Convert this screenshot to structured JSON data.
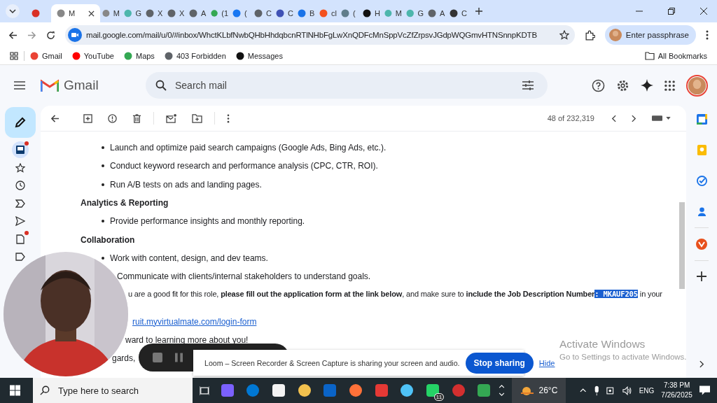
{
  "tabs": [
    {
      "selected": false
    },
    {
      "label": "M",
      "selected": true
    },
    {
      "label": "M",
      "selected": false
    },
    {
      "label": "G",
      "selected": false
    },
    {
      "label": "X",
      "selected": false
    },
    {
      "label": "X",
      "selected": false
    },
    {
      "label": "A",
      "selected": false
    },
    {
      "label": "(1",
      "selected": false
    },
    {
      "label": "(",
      "selected": false
    },
    {
      "label": "C",
      "selected": false
    },
    {
      "label": "C",
      "selected": false
    },
    {
      "label": "B",
      "selected": false
    },
    {
      "label": "cl",
      "selected": false
    },
    {
      "label": "(",
      "selected": false
    },
    {
      "label": "H",
      "selected": false
    },
    {
      "label": "M",
      "selected": false
    },
    {
      "label": "G",
      "selected": false
    },
    {
      "label": "A",
      "selected": false
    },
    {
      "label": "C",
      "selected": false
    }
  ],
  "address_bar": {
    "url": "mail.google.com/mail/u/0/#inbox/WhctKLbfNwbQHbHhdqbcnRTlNHbFgLwXnQDFcMnSppVcZfZrpsvJGdpWQGmvHTNSnnpKDTB"
  },
  "profile_button": "Enter passphrase",
  "bookmarks": [
    "Gmail",
    "YouTube",
    "Maps",
    "403 Forbidden",
    "Messages"
  ],
  "all_bookmarks": "All Bookmarks",
  "gmail": {
    "logo": "Gmail",
    "search": {
      "placeholder": "Search mail"
    },
    "counter": "48 of 232,319"
  },
  "sidebar": [
    {
      "badge": true,
      "selected": true
    },
    {
      "badge": false,
      "selected": false
    },
    {
      "badge": false,
      "selected": false
    },
    {
      "badge": false,
      "selected": false
    },
    {
      "badge": false,
      "selected": false
    },
    {
      "badge": true,
      "selected": false
    },
    {
      "badge": false,
      "selected": false
    }
  ],
  "email_lines": [
    {
      "kind": "bullet",
      "text": "Launch and optimize paid search campaigns (Google Ads, Bing Ads, etc.)."
    },
    {
      "kind": "bullet",
      "text": "Conduct keyword research and performance analysis (CPC, CTR, ROI)."
    },
    {
      "kind": "bullet",
      "text": "Run A/B tests on ads and landing pages."
    },
    {
      "kind": "heading",
      "text": "Analytics & Reporting"
    },
    {
      "kind": "bullet",
      "text": "Provide performance insights and monthly reporting."
    },
    {
      "kind": "heading",
      "text": "Collaboration"
    },
    {
      "kind": "bullet",
      "text": "Work with content, design, and dev teams."
    },
    {
      "kind": "partial",
      "text": "Communicate with clients/internal stakeholders to understand goals."
    },
    {
      "kind": "para",
      "text": "u are a good fit for this role, **please fill out the application form at the link below**, and make sure to **include the Job Description Number**",
      "selection": ": MKAUF205",
      "after": " in your"
    },
    {
      "kind": "link",
      "text": "ruit.myvirtualmate.com/login-form"
    },
    {
      "kind": "partial",
      "text": "ward to learning more about you!"
    },
    {
      "kind": "partial",
      "text": "gards,"
    }
  ],
  "loom": {
    "message": "Loom – Screen Recorder & Screen Capture is sharing your screen and audio.",
    "stop": "Stop sharing",
    "hide": "Hide"
  },
  "activation": {
    "title": "Activate Windows",
    "subtitle": "Go to Settings to activate Windows."
  },
  "taskbar": {
    "search": {
      "placeholder": "Type here to search"
    },
    "whatsapp_badge": "11",
    "weather": "26°C",
    "language": "ENG",
    "time": "7:38 PM",
    "date": "7/26/2025"
  }
}
